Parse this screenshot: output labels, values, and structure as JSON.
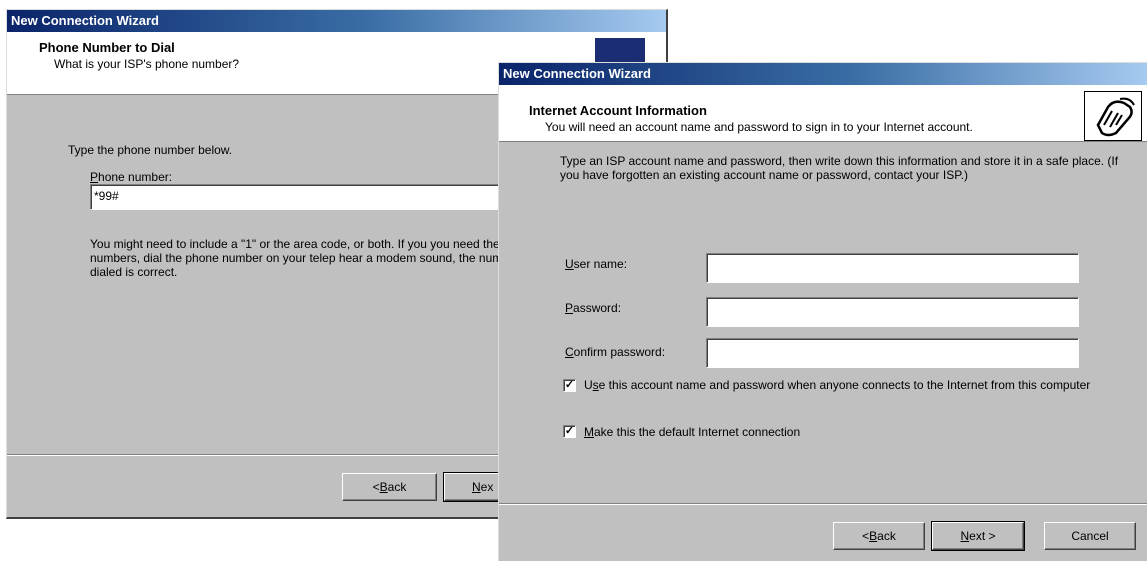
{
  "back_window": {
    "title": "New Connection Wizard",
    "header_title": "Phone Number to Dial",
    "header_subtitle": "What is your ISP's phone number?",
    "instruction": "Type the phone number below.",
    "phone_label_mnemonic": "P",
    "phone_label_rest": "hone number:",
    "phone_value": "*99#",
    "note": "You might need to include a \"1\" or the area code, or both. If you you need the extra numbers, dial the phone number on your telep hear a modem sound, the number dialed is correct.",
    "back_button": {
      "pre": "< ",
      "mnemonic": "B",
      "rest": "ack"
    },
    "next_button": {
      "mnemonic": "N",
      "rest": "ex"
    }
  },
  "front_window": {
    "title": "New Connection Wizard",
    "header_title": "Internet Account Information",
    "header_subtitle": "You will need an account name and password to sign in to your Internet account.",
    "instruction": "Type an ISP account name and password, then write down this information and store it in a safe place. (If you have forgotten an existing account name or password, contact your ISP.)",
    "user_label": {
      "mnemonic": "U",
      "rest": "ser name:"
    },
    "password_label": {
      "mnemonic": "P",
      "rest": "assword:"
    },
    "confirm_label": {
      "mnemonic": "C",
      "rest": "onfirm password:"
    },
    "user_value": "",
    "password_value": "",
    "confirm_value": "",
    "checkbox_use_account": {
      "checked": true,
      "pre": "U",
      "mnemonic": "s",
      "rest": "e this account  name and password when anyone connects to the Internet from this computer"
    },
    "checkbox_default": {
      "checked": true,
      "mnemonic": "M",
      "rest": "ake this the default Internet connection"
    },
    "back_button": {
      "pre": "< ",
      "mnemonic": "B",
      "rest": "ack"
    },
    "next_button": {
      "mnemonic": "N",
      "rest": "ext >"
    },
    "cancel_button": "Cancel"
  }
}
